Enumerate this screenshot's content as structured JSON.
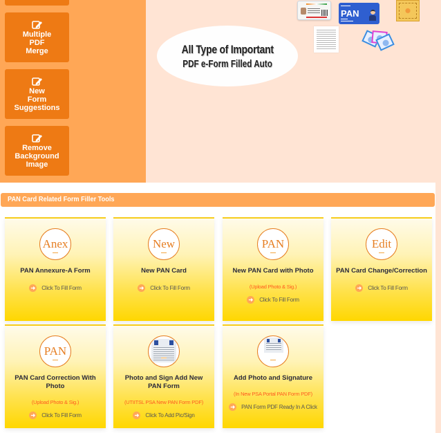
{
  "sidebar": {
    "buttons": [
      {
        "label": "Multiple\nPDF\nMerge",
        "icon": "edit-icon"
      },
      {
        "label": "New\nForm\nSuggestions",
        "icon": "edit-icon"
      },
      {
        "label": "Remove\nBackground\nImage",
        "icon": "edit-icon"
      }
    ]
  },
  "banner": {
    "line1": "All Type of Important",
    "line2": "PDF e-Form Filled Auto",
    "pan_card_label": "PAN"
  },
  "section": {
    "title": "PAN Card Related Form Filler Tools",
    "cards": [
      {
        "badge": "Anex",
        "title": "PAN Annexure-A Form",
        "subtitle": "",
        "link": "Click To Fill Form"
      },
      {
        "badge": "New",
        "title": "New PAN Card",
        "subtitle": "",
        "link": "Click To Fill Form"
      },
      {
        "badge": "PAN",
        "title": "New PAN Card with Photo",
        "subtitle": "(Upload Photo & Sig.)",
        "link": "Click To Fill Form"
      },
      {
        "badge": "Edit",
        "title": "PAN Card Change/Correction",
        "subtitle": "",
        "link": "Click To Fill Form"
      },
      {
        "badge": "PAN",
        "title": "PAN Card Correction With Photo",
        "subtitle": "(Upload Photo & Sig.)",
        "link": "Click To Fill Form"
      },
      {
        "badge": "",
        "title": "Photo and Sign Add New PAN Form",
        "subtitle": "(UTIITSL PSA New PAN Form PDF)",
        "link": "Click To Add Pic/Sign"
      },
      {
        "badge": "",
        "title": "Add Photo and Signature",
        "subtitle": "(In New PSA Portal PAN Form PDF)",
        "link": "PAN Form PDF Ready In A Click"
      }
    ]
  },
  "colors": {
    "sidebar_bg": "#ffa756",
    "sidebar_button": "#ee7a14",
    "banner_bg": "#ffe4d4",
    "card_gradient_end": "#ffd700",
    "accent_orange": "#e67e22",
    "subtitle_red": "#ff5a1f"
  }
}
